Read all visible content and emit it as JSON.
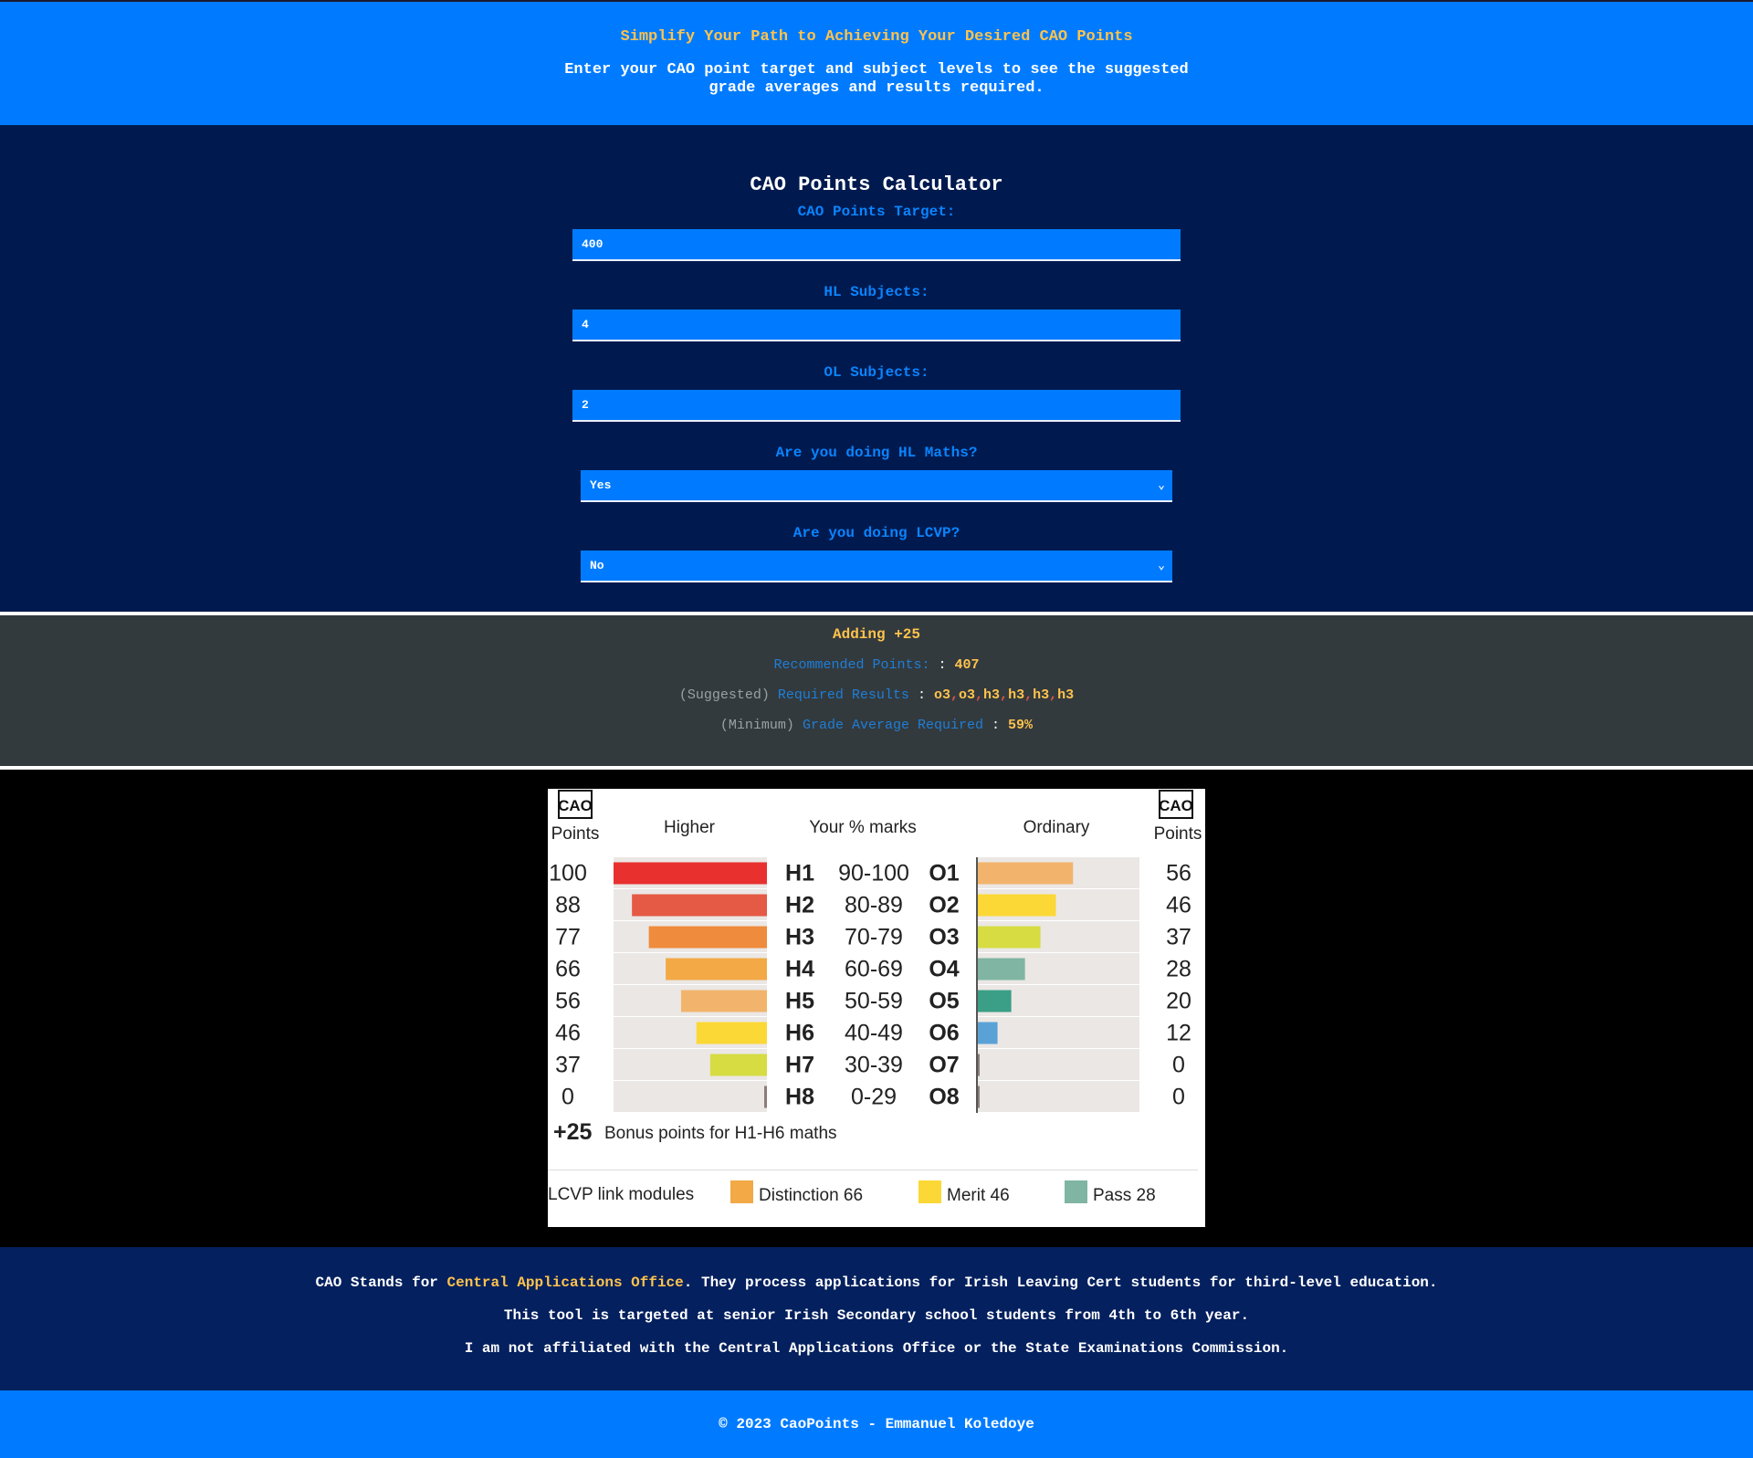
{
  "hero": {
    "tagline": "Simplify Your Path to Achieving Your Desired CAO Points",
    "intro": "Enter your CAO point target and subject levels to see the suggested grade averages and results required."
  },
  "calculator": {
    "title": "CAO Points Calculator",
    "target_label": "CAO Points Target:",
    "target_value": "400",
    "hl_label": "HL Subjects:",
    "hl_value": "4",
    "ol_label": "OL Subjects:",
    "ol_value": "2",
    "maths_label": "Are you doing HL Maths?",
    "maths_value": "Yes",
    "lcvp_label": "Are you doing LCVP?",
    "lcvp_value": "No"
  },
  "results": {
    "adding": "Adding +25",
    "recommended_label": "Recommended Points:",
    "recommended_sep": ":",
    "recommended_value": "407",
    "suggested_prefix": "(Suggested)",
    "required_label": "Required Results",
    "required_sep": ":",
    "required_results": [
      "o3",
      "o3",
      "h3",
      "h3",
      "h3",
      "h3"
    ],
    "minimum_prefix": "(Minimum)",
    "average_label": "Grade Average Required",
    "average_sep": ":",
    "average_value": "59%"
  },
  "chart_data": {
    "type": "table",
    "headers": {
      "left_points": "Points",
      "higher": "Higher",
      "marks": "Your % marks",
      "ordinary": "Ordinary",
      "right_points": "Points"
    },
    "logo_text": "CAO",
    "rows": [
      {
        "hl_points": 100,
        "hl_grade": "H1",
        "range": "90-100",
        "ol_grade": "O1",
        "ol_points": 56,
        "hl_color": "#e8312f",
        "ol_color": "#f2b46c"
      },
      {
        "hl_points": 88,
        "hl_grade": "H2",
        "range": "80-89",
        "ol_grade": "O2",
        "ol_points": 46,
        "hl_color": "#e45a44",
        "ol_color": "#fbd836"
      },
      {
        "hl_points": 77,
        "hl_grade": "H3",
        "range": "70-79",
        "ol_grade": "O3",
        "ol_points": 37,
        "hl_color": "#ef8b3c",
        "ol_color": "#d6dc42"
      },
      {
        "hl_points": 66,
        "hl_grade": "H4",
        "range": "60-69",
        "ol_grade": "O4",
        "ol_points": 28,
        "hl_color": "#f2a946",
        "ol_color": "#7fb5a2"
      },
      {
        "hl_points": 56,
        "hl_grade": "H5",
        "range": "50-59",
        "ol_grade": "O5",
        "ol_points": 20,
        "hl_color": "#f2b46c",
        "ol_color": "#3a9f86"
      },
      {
        "hl_points": 46,
        "hl_grade": "H6",
        "range": "40-49",
        "ol_grade": "O6",
        "ol_points": 12,
        "hl_color": "#fbd836",
        "ol_color": "#5aa2d6"
      },
      {
        "hl_points": 37,
        "hl_grade": "H7",
        "range": "30-39",
        "ol_grade": "O7",
        "ol_points": 0,
        "hl_color": "#d6dc42",
        "ol_color": "#8c7c78"
      },
      {
        "hl_points": 0,
        "hl_grade": "H8",
        "range": "0-29",
        "ol_grade": "O8",
        "ol_points": 0,
        "hl_color": "#8c7c78",
        "ol_color": "#8c7c78"
      }
    ],
    "bonus_value": "+25",
    "bonus_text": "Bonus points for H1-H6 maths",
    "lcvp_label": "LCVP link modules",
    "lcvp_items": [
      {
        "label": "Distinction 66",
        "color": "#f2a946"
      },
      {
        "label": "Merit 46",
        "color": "#fbd836"
      },
      {
        "label": "Pass 28",
        "color": "#7fb5a2"
      }
    ],
    "track_color": "#ebe7e5",
    "hl_max": 100,
    "ol_max": 100
  },
  "info": {
    "line1_prefix": "CAO Stands for ",
    "line1_highlight": "Central Applications Office",
    "line1_suffix": ". They process applications for Irish Leaving Cert students for third-level education.",
    "line2": "This tool is targeted at senior Irish Secondary school students from 4th to 6th year.",
    "line3": "I am not affiliated with the Central Applications Office or the State Examinations Commission."
  },
  "footer": {
    "text": "© 2023 CaoPoints - Emmanuel Koledoye"
  }
}
